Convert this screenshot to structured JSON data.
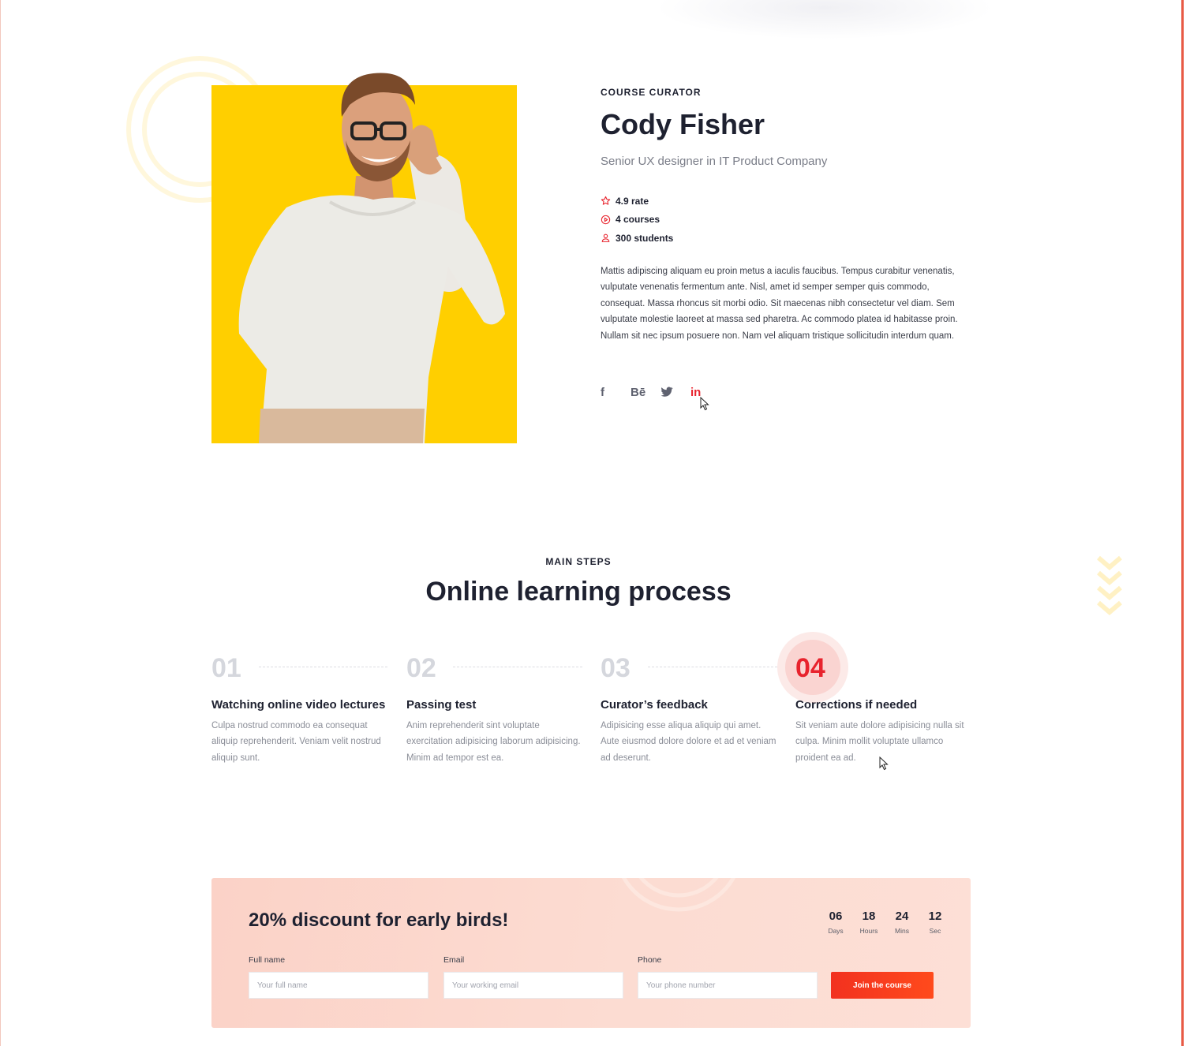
{
  "curator": {
    "label": "COURSE CURATOR",
    "name": "Cody Fisher",
    "role": "Senior UX designer in IT Product Company",
    "stats": [
      {
        "icon": "star-icon",
        "text": "4.9 rate"
      },
      {
        "icon": "play-circle-icon",
        "text": "4 courses"
      },
      {
        "icon": "user-icon",
        "text": "300 students"
      }
    ],
    "bio": "Mattis adipiscing aliquam eu proin metus a iaculis faucibus. Tempus curabitur venenatis, vulputate venenatis fermentum ante. Nisl, amet id semper semper quis commodo, consequat. Massa rhoncus sit morbi odio. Sit maecenas nibh consectetur vel diam. Sem vulputate molestie laoreet at massa sed pharetra. Ac commodo platea id habitasse proin. Nullam sit nec ipsum posuere non. Nam vel aliquam tristique sollicitudin interdum quam.",
    "socials": [
      {
        "icon": "facebook-icon",
        "glyph": "f"
      },
      {
        "icon": "behance-icon",
        "glyph": "Bē"
      },
      {
        "icon": "twitter-icon",
        "glyph": ""
      },
      {
        "icon": "linkedin-icon",
        "glyph": "in"
      }
    ]
  },
  "steps": {
    "label": "MAIN STEPS",
    "title": "Online learning process",
    "items": [
      {
        "num": "01",
        "title": "Watching online video lectures",
        "desc": "Culpa nostrud commodo ea consequat aliquip reprehenderit. Veniam velit nostrud aliquip sunt."
      },
      {
        "num": "02",
        "title": "Passing test",
        "desc": "Anim reprehenderit sint voluptate exercitation adipisicing laborum adipisicing. Minim ad tempor est ea."
      },
      {
        "num": "03",
        "title": "Curator’s feedback",
        "desc": "Adipisicing esse aliqua aliquip qui amet. Aute eiusmod dolore dolore et ad et veniam ad deserunt."
      },
      {
        "num": "04",
        "title": "Corrections if needed",
        "desc": "Sit veniam aute dolore adipisicing nulla sit culpa. Minim mollit voluptate ullamco proident ea ad."
      }
    ]
  },
  "promo": {
    "title": "20% discount for early birds!",
    "countdown": [
      {
        "value": "06",
        "label": "Days"
      },
      {
        "value": "18",
        "label": "Hours"
      },
      {
        "value": "24",
        "label": "Mins"
      },
      {
        "value": "12",
        "label": "Sec"
      }
    ],
    "fields": [
      {
        "label": "Full name",
        "placeholder": "Your full name"
      },
      {
        "label": "Email",
        "placeholder": "Your working email"
      },
      {
        "label": "Phone",
        "placeholder": "Your phone number"
      }
    ],
    "button": "Join the course"
  },
  "colors": {
    "accent": "#e8232d",
    "photo_bg": "#ffcf00",
    "promo_bg": "#fbd2c7"
  }
}
